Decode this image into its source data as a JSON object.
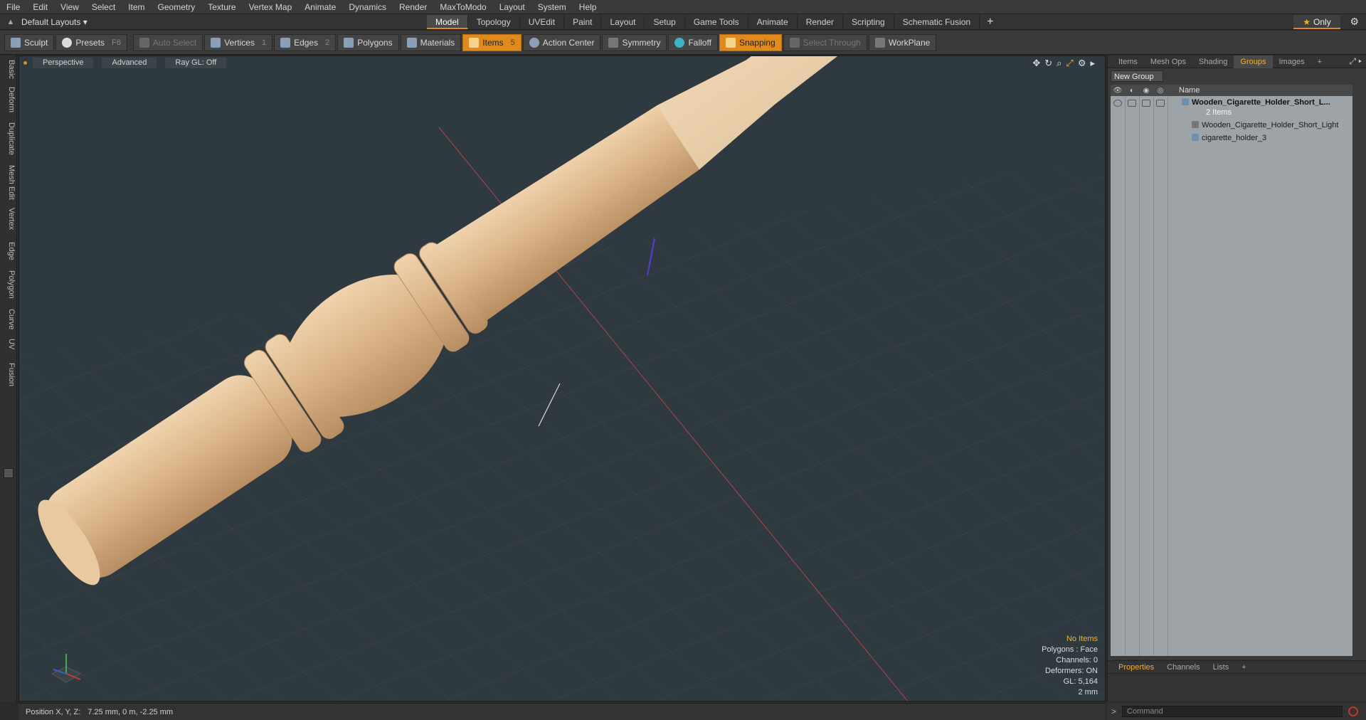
{
  "menu": [
    "File",
    "Edit",
    "View",
    "Select",
    "Item",
    "Geometry",
    "Texture",
    "Vertex Map",
    "Animate",
    "Dynamics",
    "Render",
    "MaxToModo",
    "Layout",
    "System",
    "Help"
  ],
  "layout_selector": "Default Layouts ▾",
  "mode_tabs": [
    "Model",
    "Topology",
    "UVEdit",
    "Paint",
    "Layout",
    "Setup",
    "Game Tools",
    "Animate",
    "Render",
    "Scripting",
    "Schematic Fusion"
  ],
  "active_mode_tab": "Model",
  "only_label": "Only",
  "toolbar": {
    "sculpt": "Sculpt",
    "presets": "Presets",
    "presets_key": "F6",
    "auto_select": "Auto Select",
    "vertices": "Vertices",
    "vertices_count": "1",
    "edges": "Edges",
    "edges_count": "2",
    "polygons": "Polygons",
    "materials": "Materials",
    "items": "Items",
    "items_count": "5",
    "action_center": "Action Center",
    "symmetry": "Symmetry",
    "falloff": "Falloff",
    "snapping": "Snapping",
    "select_through": "Select Through",
    "workplane": "WorkPlane"
  },
  "left_tabs": [
    "Basic",
    "Deform",
    "Duplicate",
    "Mesh Edit",
    "Vertex",
    "Edge",
    "Polygon",
    "Curve",
    "UV",
    "Fusion"
  ],
  "viewport": {
    "view": "Perspective",
    "advanced": "Advanced",
    "raygl": "Ray GL: Off",
    "info": {
      "selection": "No Items",
      "polygons": "Polygons : Face",
      "channels": "Channels: 0",
      "deformers": "Deformers: ON",
      "gl": "GL: 5,164",
      "grid": "2 mm"
    }
  },
  "status": {
    "label": "Position X, Y, Z:",
    "value": "7.25 mm, 0 m, -2.25 mm"
  },
  "right_panel": {
    "tabs": [
      "Items",
      "Mesh Ops",
      "Shading",
      "Groups",
      "Images"
    ],
    "active_tab": "Groups",
    "new_group": "New Group",
    "column_name": "Name",
    "rows": [
      {
        "name": "Wooden_Cigarette_Holder_Short_L...",
        "sub": "2 Items"
      },
      {
        "name": "Wooden_Cigarette_Holder_Short_Light"
      },
      {
        "name": "cigarette_holder_3"
      }
    ],
    "bottom_tabs": [
      "Properties",
      "Channels",
      "Lists"
    ],
    "bottom_active": "Properties",
    "command_placeholder": "Command"
  },
  "colors": {
    "accent": "#e08a1e",
    "viewport_bg": "#2f3a40",
    "wood": "#d8b48a"
  }
}
